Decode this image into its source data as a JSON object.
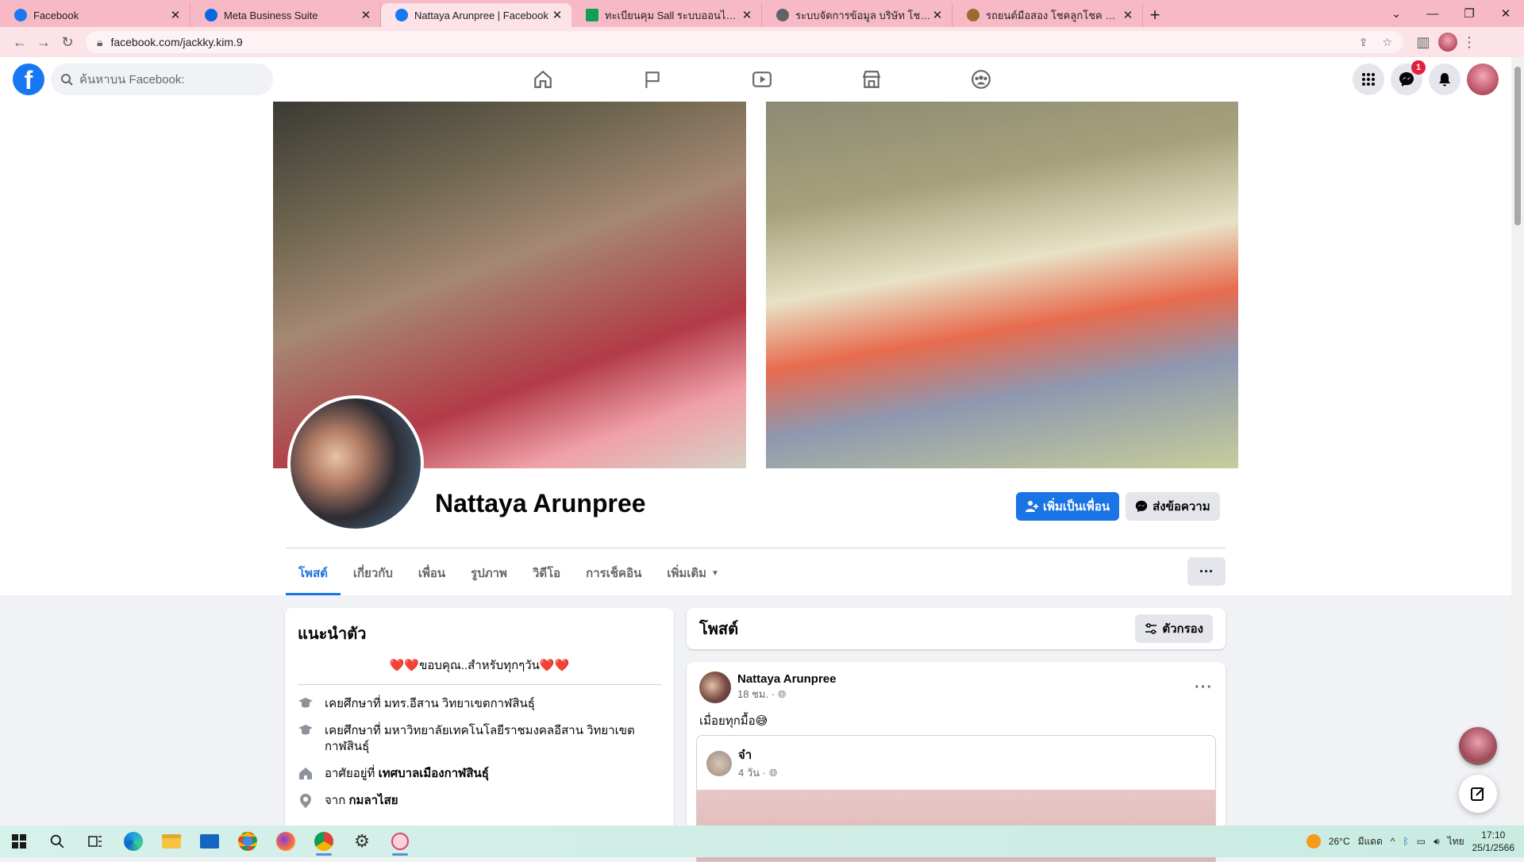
{
  "browser": {
    "tabs": [
      {
        "title": "Facebook",
        "icon": "facebook-icon",
        "active": false
      },
      {
        "title": "Meta Business Suite",
        "icon": "meta-icon",
        "active": false
      },
      {
        "title": "Nattaya Arunpree | Facebook",
        "icon": "facebook-icon",
        "active": true
      },
      {
        "title": "ทะเบียนคุม Sall ระบบออนไลน์.xlsx - G",
        "icon": "sheets-icon",
        "active": false
      },
      {
        "title": "ระบบจัดการข้อมูล บริษัท โชคลูกโชค",
        "icon": "globe-icon",
        "active": false
      },
      {
        "title": "รถยนต์มือสอง โชคลูกโชค อุดรธานี",
        "icon": "site-icon",
        "active": false
      }
    ],
    "url": "facebook.com/jackky.kim.9"
  },
  "fb": {
    "search_placeholder": "ค้นหาบน Facebook:",
    "messenger_badge": "1"
  },
  "profile": {
    "name": "Nattaya Arunpree",
    "add_friend": "เพิ่มเป็นเพื่อน",
    "message": "ส่งข้อความ",
    "tabs": [
      "โพสต์",
      "เกี่ยวกับ",
      "เพื่อน",
      "รูปภาพ",
      "วิดีโอ",
      "การเช็คอิน",
      "เพิ่มเติม"
    ]
  },
  "intro": {
    "title": "แนะนำตัว",
    "bio": "❤️❤️ขอบคุณ..สำหรับทุกๆวัน❤️❤️",
    "rows": [
      {
        "icon": "graduation-cap-icon",
        "prefix": "เคยศึกษาที่ มทร.อีสาน วิทยาเขตกาฬสินธุ์",
        "bold": ""
      },
      {
        "icon": "graduation-cap-icon",
        "prefix": "เคยศึกษาที่ มหาวิทยาลัยเทคโนโลยีราชมงคลอีสาน วิทยาเขตกาฬสินธุ์",
        "bold": ""
      },
      {
        "icon": "home-icon",
        "prefix": "อาศัยอยู่ที่ ",
        "bold": "เทศบาลเมืองกาฬสินธุ์"
      },
      {
        "icon": "location-pin-icon",
        "prefix": "จาก ",
        "bold": "กมลาไสย"
      }
    ]
  },
  "posts": {
    "title": "โพสต์",
    "filter": "ตัวกรอง",
    "post": {
      "author": "Nattaya Arunpree",
      "time": "18 ชม. ·",
      "text": "เมื่อยทุกมื้อ😅",
      "shared_author": "จ๋า",
      "shared_time": "4 วัน ·"
    }
  },
  "taskbar": {
    "weather": "26°C",
    "weather_desc": "มีแดด",
    "lang": "ไทย",
    "time": "17:10",
    "date": "25/1/2566"
  }
}
